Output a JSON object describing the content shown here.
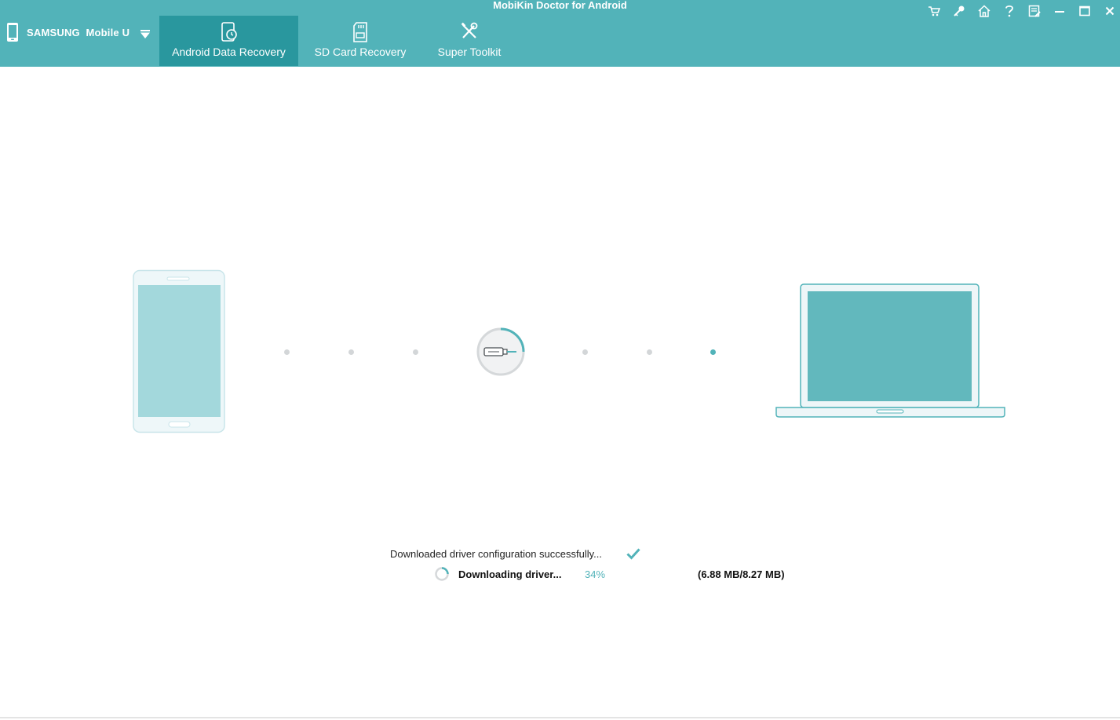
{
  "app": {
    "title": "MobiKin Doctor for Android"
  },
  "device": {
    "name": "SAMSUNG  Mobile U"
  },
  "tabs": [
    {
      "label": "Android Data Recovery",
      "active": true
    },
    {
      "label": "SD Card Recovery",
      "active": false
    },
    {
      "label": "Super Toolkit",
      "active": false
    }
  ],
  "window_controls": [
    "cart-icon",
    "key-icon",
    "home-icon",
    "help-icon",
    "feedback-icon",
    "minimize-icon",
    "maximize-icon",
    "close-icon"
  ],
  "status": {
    "config_message": "Downloaded driver configuration successfully...",
    "driver_message": "Downloading driver...",
    "progress_percent": "34%",
    "progress_fraction": 0.34,
    "size_text": "(6.88 MB/8.27 MB)"
  },
  "colors": {
    "accent": "#52b3b9",
    "active_tab": "#29979e"
  }
}
